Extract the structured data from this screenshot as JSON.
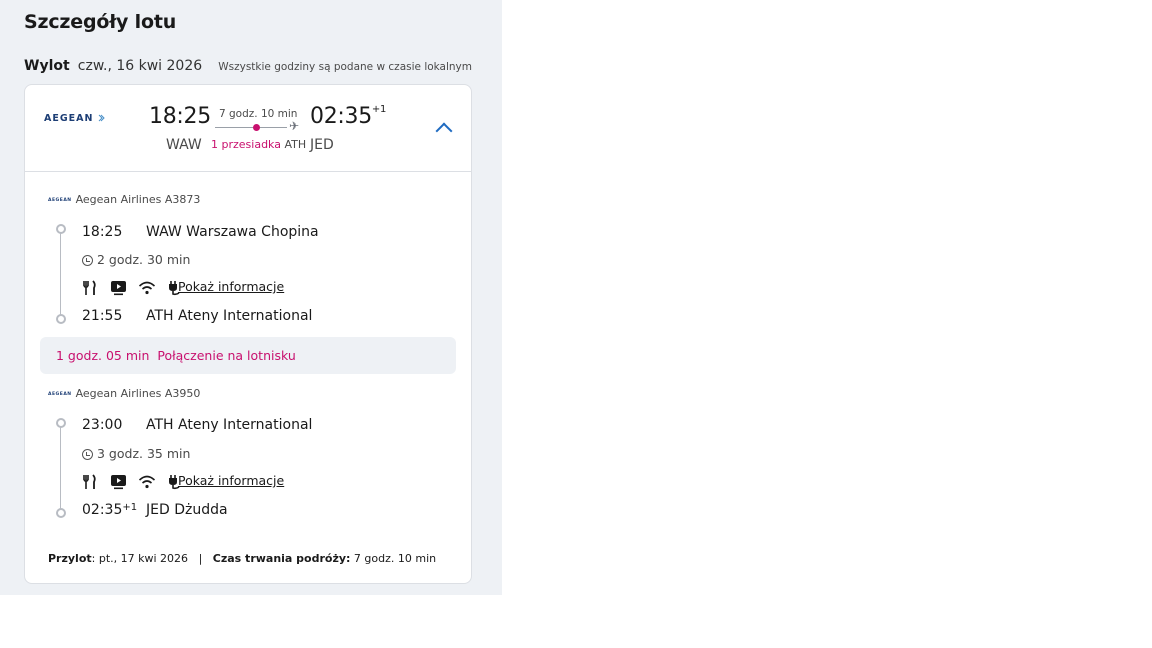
{
  "title": "Szczegóły lotu",
  "departure": {
    "label": "Wylot",
    "date": "czw., 16 kwi 2026",
    "tz_note": "Wszystkie godziny są podane w czasie lokalnym"
  },
  "summary": {
    "logo": "AEGEAN",
    "dep_time": "18:25",
    "dep_code": "WAW",
    "duration": "7 godz. 10 min",
    "stops": "1 przesiadka",
    "stop_code": "ATH",
    "arr_time": "02:35",
    "arr_offset": "+1",
    "arr_code": "JED",
    "accent_color": "#c8106e",
    "link_color": "#1f6bc1"
  },
  "segments": [
    {
      "logo": "AEGEAN",
      "airline": "Aegean Airlines A3873",
      "dep_time": "18:25",
      "dep_airport": "WAW Warszawa Chopina",
      "duration": "2 godz. 30 min",
      "info_link": "Pokaż informacje",
      "arr_time": "21:55",
      "arr_offset": "",
      "arr_airport": "ATH Ateny International"
    },
    {
      "logo": "AEGEAN",
      "airline": "Aegean Airlines A3950",
      "dep_time": "23:00",
      "dep_airport": "ATH Ateny International",
      "duration": "3 godz. 35 min",
      "info_link": "Pokaż informacje",
      "arr_time": "02:35",
      "arr_offset": "+1",
      "arr_airport": "JED Dżudda"
    }
  ],
  "amenity_icons": [
    "meal-icon",
    "entertainment-icon",
    "wifi-icon",
    "power-plug-icon"
  ],
  "layover": {
    "duration": "1 godz. 05 min",
    "type": "Połączenie na lotnisku"
  },
  "footer": {
    "arrival_label": "Przylot",
    "arrival_value": ": pt., 17 kwi 2026",
    "separator": "|",
    "total_label": "Czas trwania podróży:",
    "total_value": " 7 godz. 10 min"
  }
}
